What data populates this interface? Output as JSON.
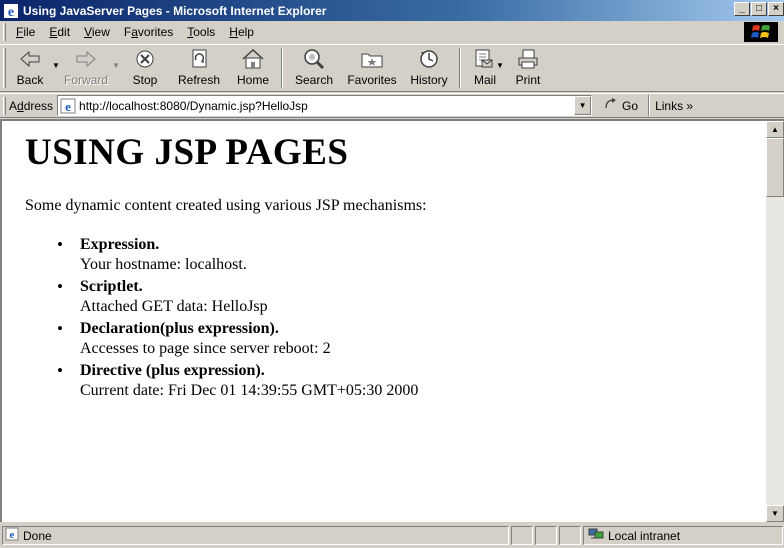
{
  "window": {
    "title": "Using JavaServer Pages - Microsoft Internet Explorer",
    "minimize": "_",
    "maximize": "□",
    "close": "×"
  },
  "menu": {
    "items": [
      {
        "accel": "F",
        "rest": "ile"
      },
      {
        "accel": "E",
        "rest": "dit"
      },
      {
        "accel": "V",
        "rest": "iew"
      },
      {
        "pre": "F",
        "accel": "a",
        "rest": "vorites"
      },
      {
        "accel": "T",
        "rest": "ools"
      },
      {
        "accel": "H",
        "rest": "elp"
      }
    ]
  },
  "toolbar": {
    "back": "Back",
    "forward": "Forward",
    "stop": "Stop",
    "refresh": "Refresh",
    "home": "Home",
    "search": "Search",
    "favorites": "Favorites",
    "history": "History",
    "mail": "Mail",
    "print": "Print"
  },
  "address": {
    "label_accel": "d",
    "label_pre": "A",
    "label_rest": "dress",
    "url": "http://localhost:8080/Dynamic.jsp?HelloJsp",
    "go": "Go",
    "links": "Links »"
  },
  "page": {
    "heading": "USING JSP PAGES",
    "intro": "Some dynamic content created using various JSP mechanisms:",
    "features": [
      {
        "title": "Expression.",
        "desc": "Your hostname: localhost."
      },
      {
        "title": "Scriptlet.",
        "desc": "Attached GET data: HelloJsp"
      },
      {
        "title": "Declaration(plus expression).",
        "desc": "Accesses to page since server reboot: 2"
      },
      {
        "title": "Directive (plus expression).",
        "desc": "Current date: Fri Dec 01 14:39:55 GMT+05:30 2000"
      }
    ]
  },
  "status": {
    "text": "Done",
    "zone": "Local intranet"
  },
  "colors": {
    "titlebar_start": "#0a246a",
    "titlebar_end": "#a6caf0",
    "chrome": "#d4d0c8",
    "page_bg": "#ffffff"
  }
}
